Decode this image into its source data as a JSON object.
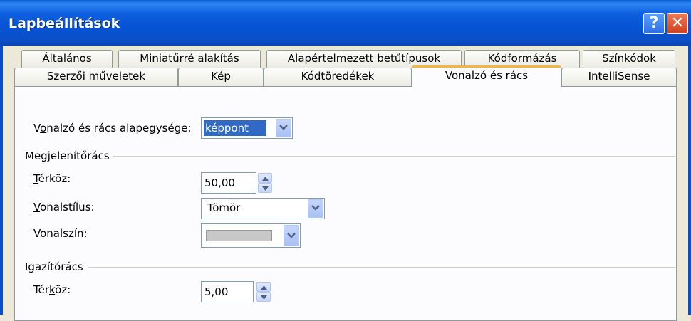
{
  "window": {
    "title": "Lapbeállítások",
    "help_label": "?",
    "close_label": "✕",
    "title_color": "#0553d4"
  },
  "tabs": {
    "row1": [
      "Általános",
      "Miniatűrré alakítás",
      "Alapértelmezett betűtípusok",
      "Kódformázás",
      "Színkódok"
    ],
    "row2": [
      "Szerzői műveletek",
      "Kép",
      "Kódtöredékek",
      "Vonalzó és rács",
      "IntelliSense"
    ],
    "active": "Vonalzó és rács"
  },
  "ruler": {
    "unit_label": {
      "pre": "V",
      "ul": "o",
      "post": "nalzó és rács alapegysége:"
    },
    "unit_value": "képpont"
  },
  "display_grid": {
    "title": "Megjelenítőrács",
    "spacing_label": {
      "pre": "",
      "ul": "T",
      "post": "érköz:"
    },
    "spacing_value": "50,00",
    "line_style_label": {
      "pre": "",
      "ul": "V",
      "post": "onalstílus:"
    },
    "line_style_value": "Tömör",
    "line_color_label": {
      "pre": "Vonal",
      "ul": "s",
      "post": "zín:"
    },
    "line_color_value": "#c8c8c8"
  },
  "snap_grid": {
    "title": "Igazítórács",
    "spacing_label": {
      "pre": "Tér",
      "ul": "k",
      "post": "öz:"
    },
    "spacing_value": "5,00"
  }
}
